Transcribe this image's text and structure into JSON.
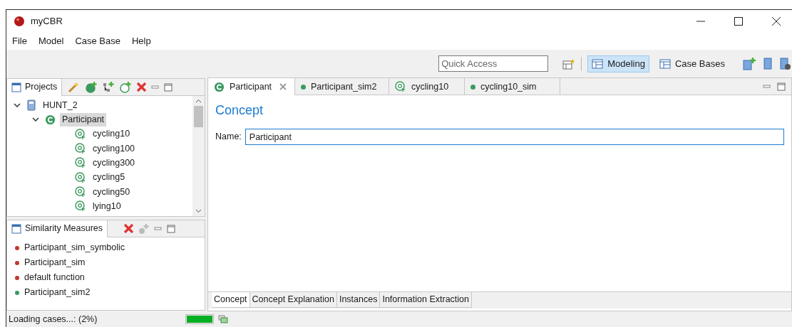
{
  "window": {
    "title": "myCBR"
  },
  "menu": [
    "File",
    "Model",
    "Case Base",
    "Help"
  ],
  "toolbar": {
    "quick_access": {
      "placeholder": "Quick Access"
    },
    "perspectives": [
      {
        "label": "Modeling",
        "selected": true
      },
      {
        "label": "Case Bases",
        "selected": false
      }
    ]
  },
  "projects": {
    "title": "Projects",
    "tree": [
      {
        "label": "HUNT_2",
        "kind": "project",
        "expanded": true,
        "selected": false,
        "children": [
          {
            "label": "Participant",
            "kind": "concept",
            "expanded": true,
            "selected": true,
            "children": [
              {
                "label": "cycling10",
                "kind": "attribute",
                "selected": false
              },
              {
                "label": "cycling100",
                "kind": "attribute",
                "selected": false
              },
              {
                "label": "cycling300",
                "kind": "attribute",
                "selected": false
              },
              {
                "label": "cycling5",
                "kind": "attribute",
                "selected": false
              },
              {
                "label": "cycling50",
                "kind": "attribute",
                "selected": false
              },
              {
                "label": "lying10",
                "kind": "attribute",
                "selected": false
              }
            ]
          }
        ]
      }
    ]
  },
  "similarity_measures": {
    "title": "Similarity Measures",
    "items": [
      {
        "label": "Participant_sim_symbolic",
        "color": "#c0392b"
      },
      {
        "label": "Participant_sim",
        "color": "#c0392b"
      },
      {
        "label": "default function",
        "color": "#c0392b"
      },
      {
        "label": "Participant_sim2",
        "color": "#3c9a5f"
      }
    ]
  },
  "editor_tabs": [
    {
      "label": "Participant",
      "kind": "concept",
      "selected": true
    },
    {
      "label": "Participant_sim2",
      "kind": "measure",
      "selected": false
    },
    {
      "label": "cycling10",
      "kind": "attribute",
      "selected": false
    },
    {
      "label": "cycling10_sim",
      "kind": "measure",
      "selected": false
    }
  ],
  "concept": {
    "heading": "Concept",
    "name_label": "Name:",
    "name_value": "Participant"
  },
  "bottom_tabs": [
    {
      "label": "Concept",
      "selected": true
    },
    {
      "label": "Concept Explanation",
      "selected": false
    },
    {
      "label": "Instances",
      "selected": false
    },
    {
      "label": "Information Extraction",
      "selected": false
    }
  ],
  "status_bar": {
    "text": "Loading cases...: (2%)",
    "level": 1
  }
}
